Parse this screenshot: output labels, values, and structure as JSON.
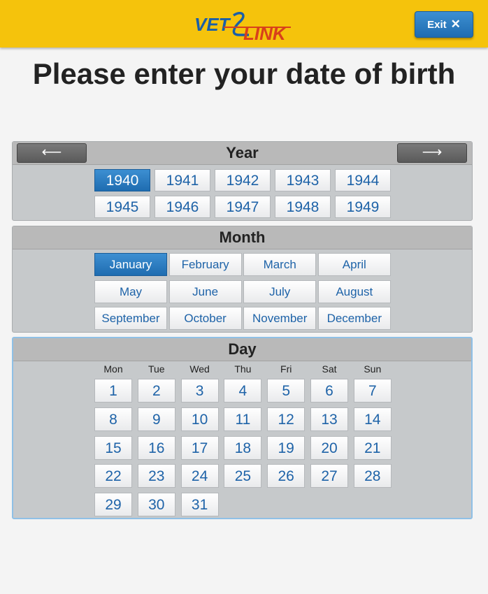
{
  "header": {
    "logo": {
      "part1": "VET",
      "part2": "LINK"
    },
    "exit_label": "Exit",
    "exit_icon": "close-icon"
  },
  "title": "Please enter your date of birth",
  "year_panel": {
    "heading": "Year",
    "prev_icon": "arrow-left-icon",
    "next_icon": "arrow-right-icon",
    "years": [
      "1940",
      "1941",
      "1942",
      "1943",
      "1944",
      "1945",
      "1946",
      "1947",
      "1948",
      "1949"
    ],
    "selected": "1940"
  },
  "month_panel": {
    "heading": "Month",
    "months": [
      "January",
      "February",
      "March",
      "April",
      "May",
      "June",
      "July",
      "August",
      "September",
      "October",
      "November",
      "December"
    ],
    "selected": "January"
  },
  "day_panel": {
    "heading": "Day",
    "weekdays": [
      "Mon",
      "Tue",
      "Wed",
      "Thu",
      "Fri",
      "Sat",
      "Sun"
    ],
    "days": [
      "1",
      "2",
      "3",
      "4",
      "5",
      "6",
      "7",
      "8",
      "9",
      "10",
      "11",
      "12",
      "13",
      "14",
      "15",
      "16",
      "17",
      "18",
      "19",
      "20",
      "21",
      "22",
      "23",
      "24",
      "25",
      "26",
      "27",
      "28",
      "29",
      "30",
      "31"
    ]
  },
  "colors": {
    "header": "#f5c30c",
    "selected": "#1f6cb0",
    "button_text": "#1e63a8",
    "panel": "#c6c9cb"
  }
}
